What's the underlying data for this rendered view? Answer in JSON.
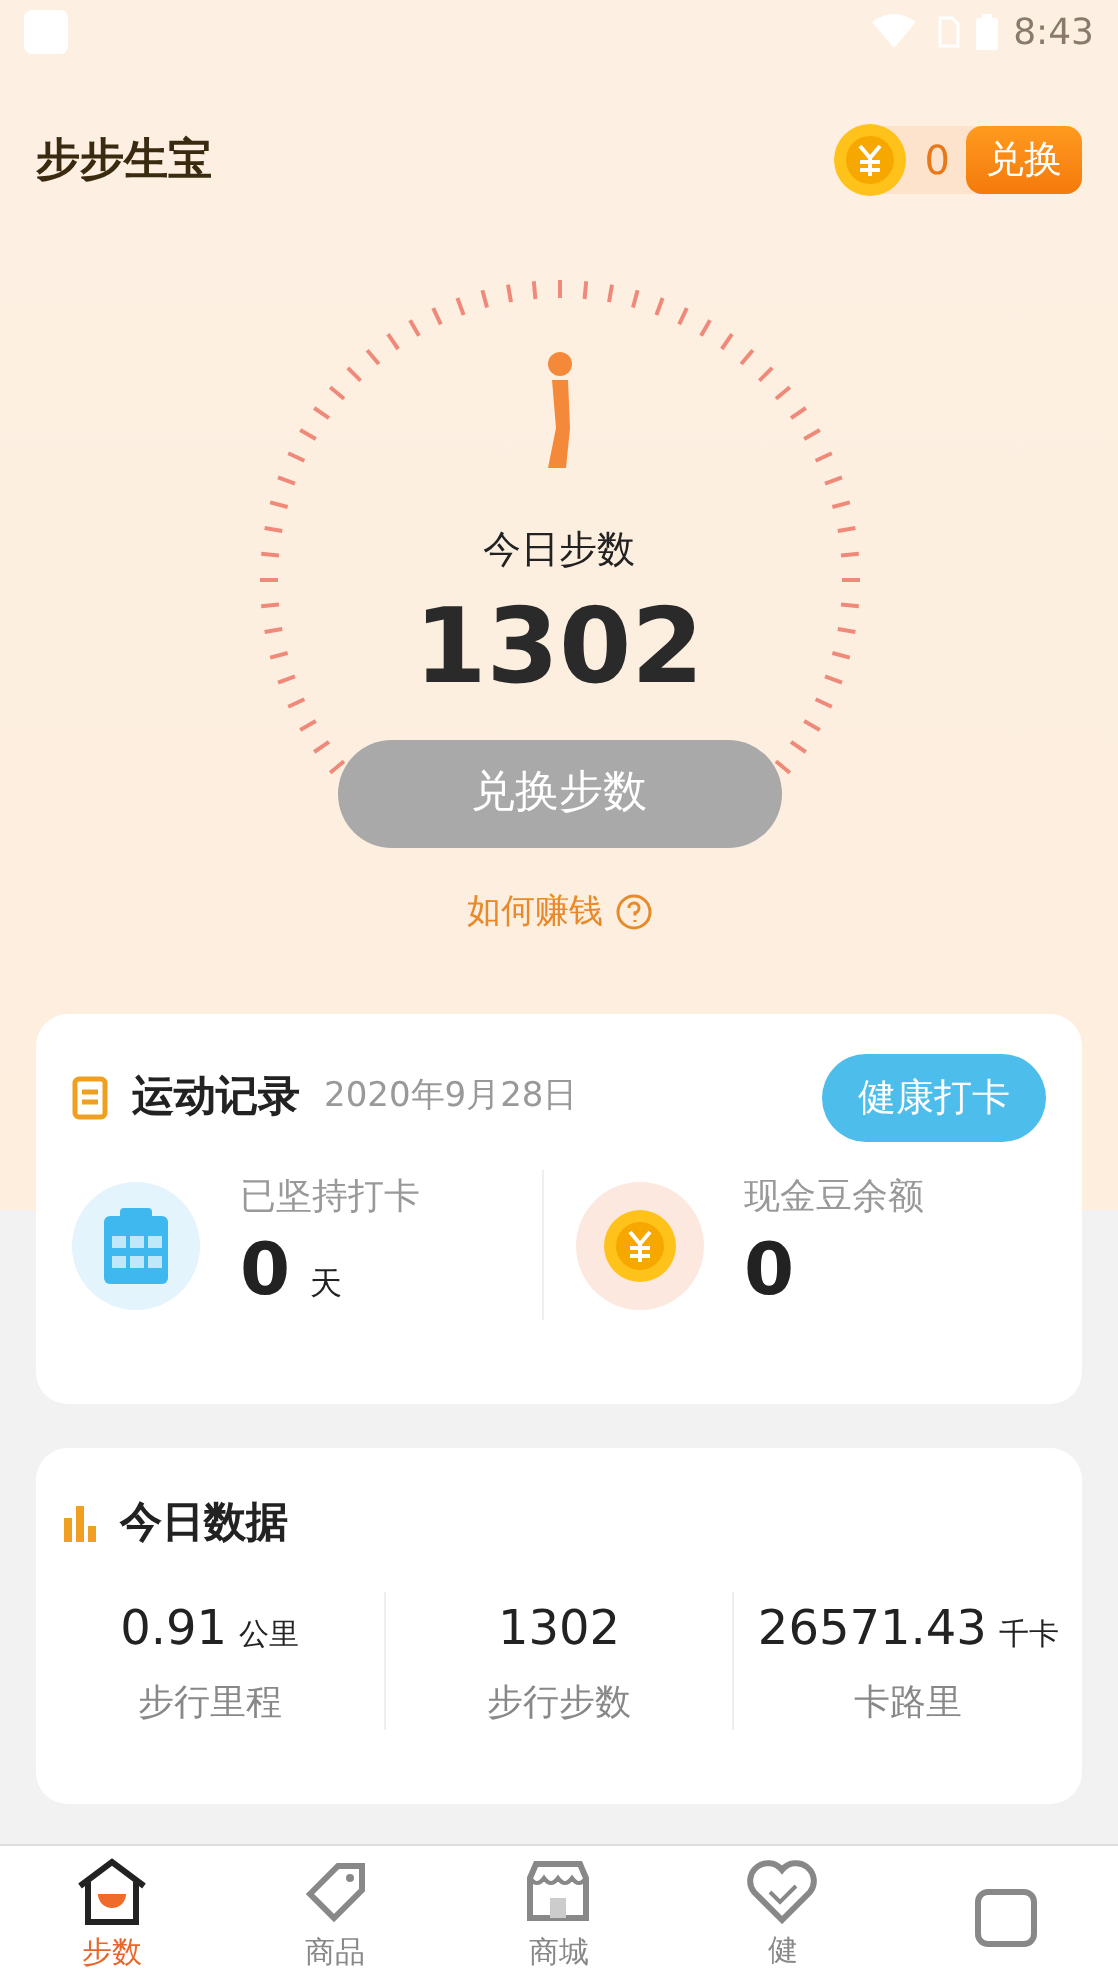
{
  "status_bar": {
    "time": "8:43"
  },
  "header": {
    "title": "步步生宝",
    "coin_balance": "0",
    "exchange_button": "兑换"
  },
  "steps": {
    "label": "今日步数",
    "count": "1302",
    "button": {
      "label": "兑换步数",
      "disabled": true
    },
    "help_link": "如何赚钱"
  },
  "exercise_record": {
    "title": "运动记录",
    "date": "2020年9月28日",
    "checkin_button": "健康打卡",
    "stats": [
      {
        "kind": "calendar",
        "label": "已坚持打卡",
        "value": "0",
        "unit": "天"
      },
      {
        "kind": "coin",
        "label": "现金豆余额",
        "value": "0"
      }
    ]
  },
  "today_data": {
    "title": "今日数据",
    "metrics": [
      {
        "value": "0.91",
        "unit": "公里",
        "label": "步行里程"
      },
      {
        "value": "1302",
        "label": "步行步数"
      },
      {
        "value": "26571.43",
        "unit": "千卡",
        "label": "卡路里"
      }
    ]
  },
  "bottom_nav": [
    {
      "kind": "house",
      "label": "步数",
      "selected": true
    },
    {
      "kind": "tag",
      "label": "商品",
      "selected": false
    },
    {
      "kind": "store",
      "label": "商城",
      "selected": false
    },
    {
      "kind": "heart",
      "label": "健",
      "selected": false
    },
    {
      "kind": "box",
      "selected": false
    }
  ]
}
